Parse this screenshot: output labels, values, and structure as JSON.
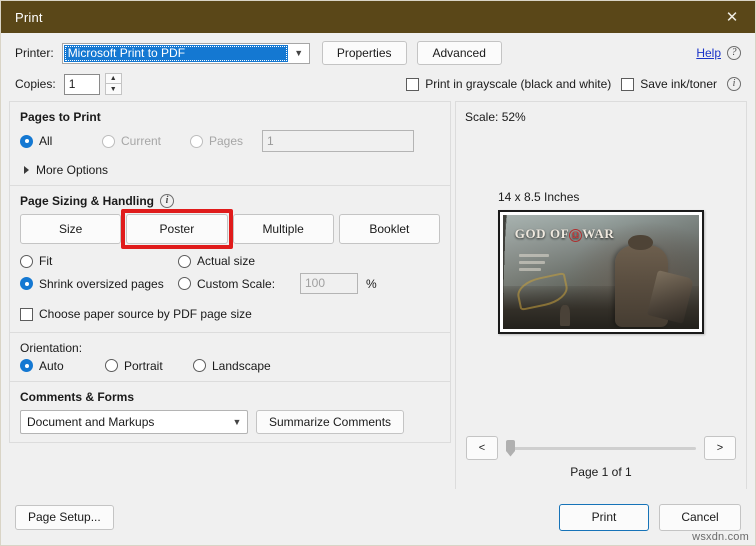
{
  "window": {
    "title": "Print",
    "close_icon": "close-icon"
  },
  "printer": {
    "label": "Printer:",
    "value": "Microsoft Print to PDF",
    "dropdown_icon": "chevron-down-icon",
    "properties_label": "Properties",
    "advanced_label": "Advanced",
    "help_label": "Help",
    "help_info_icon": "info-icon"
  },
  "copies": {
    "label": "Copies:",
    "value": "1",
    "up_icon": "spinner-up-icon",
    "down_icon": "spinner-down-icon"
  },
  "print_options": {
    "grayscale_label": "Print in grayscale (black and white)",
    "grayscale_checked": false,
    "save_ink_label": "Save ink/toner",
    "save_ink_checked": false,
    "info_icon": "info-icon"
  },
  "pages_to_print": {
    "title": "Pages to Print",
    "options": [
      {
        "label": "All",
        "selected": true,
        "disabled": false
      },
      {
        "label": "Current",
        "selected": false,
        "disabled": true
      },
      {
        "label": "Pages",
        "selected": false,
        "disabled": true
      }
    ],
    "pages_value": "1",
    "more_options_label": "More Options",
    "more_options_icon": "triangle-right-icon"
  },
  "page_sizing": {
    "title": "Page Sizing & Handling",
    "info_icon": "info-icon",
    "buttons": [
      {
        "label": "Size",
        "highlighted": false
      },
      {
        "label": "Poster",
        "highlighted": true
      },
      {
        "label": "Multiple",
        "highlighted": false
      },
      {
        "label": "Booklet",
        "highlighted": false
      }
    ],
    "highlight_color": "#e01b1b",
    "fit_label": "Fit",
    "fit_selected": false,
    "actual_size_label": "Actual size",
    "actual_size_selected": false,
    "shrink_label": "Shrink oversized pages",
    "shrink_selected": true,
    "custom_scale_label": "Custom Scale:",
    "custom_scale_selected": false,
    "custom_scale_value": "100",
    "percent_sign": "%",
    "paper_source_label": "Choose paper source by PDF page size",
    "paper_source_checked": false
  },
  "orientation": {
    "title": "Orientation:",
    "options": [
      {
        "label": "Auto",
        "selected": true
      },
      {
        "label": "Portrait",
        "selected": false
      },
      {
        "label": "Landscape",
        "selected": false
      }
    ]
  },
  "comments_forms": {
    "title": "Comments & Forms",
    "selected": "Document and Markups",
    "dropdown_icon": "chevron-down-icon",
    "summarize_label": "Summarize Comments"
  },
  "preview": {
    "scale_label": "Scale:",
    "scale_value": "52%",
    "page_dimensions": "14 x 8.5 Inches",
    "thumbnail_title": "GOD OF WAR",
    "thumbnail_omega": "Ω",
    "prev_label": "<",
    "next_label": ">",
    "page_count_label": "Page 1 of 1"
  },
  "footer": {
    "page_setup_label": "Page Setup...",
    "print_label": "Print",
    "cancel_label": "Cancel",
    "accent_color": "#1673b8"
  },
  "watermark": {
    "text": "wsxdn.com"
  }
}
